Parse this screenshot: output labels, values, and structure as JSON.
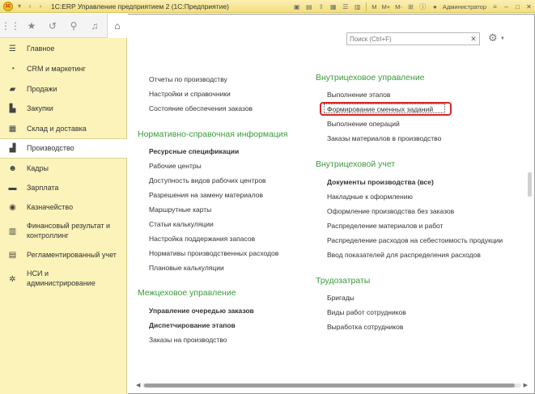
{
  "titlebar": {
    "logo": "1С",
    "title": "1С:ERP Управление предприятием 2  (1С:Предприятие)",
    "m_label": "M",
    "m_plus": "M+",
    "m_minus": "M-",
    "user": "Администратор"
  },
  "search": {
    "placeholder": "Поиск (Ctrl+F)"
  },
  "sidebar": {
    "items": [
      {
        "label": "Главное",
        "icon": "menu-icon"
      },
      {
        "label": "CRM и маркетинг",
        "icon": "crm-icon"
      },
      {
        "label": "Продажи",
        "icon": "sales-icon"
      },
      {
        "label": "Закупки",
        "icon": "cart-icon"
      },
      {
        "label": "Склад и доставка",
        "icon": "warehouse-icon"
      },
      {
        "label": "Производство",
        "icon": "factory-icon",
        "active": true
      },
      {
        "label": "Кадры",
        "icon": "person-icon"
      },
      {
        "label": "Зарплата",
        "icon": "money-icon"
      },
      {
        "label": "Казначейство",
        "icon": "treasury-icon"
      },
      {
        "label_line1": "Финансовый результат и",
        "label_line2": "контроллинг",
        "icon": "chart-icon"
      },
      {
        "label": "Регламентированный учет",
        "icon": "report-icon"
      },
      {
        "label_line1": "НСИ и",
        "label_line2": "администрирование",
        "icon": "gear-icon"
      }
    ]
  },
  "left_column": {
    "top_links": [
      "Отчеты по производству",
      "Настройки и справочники",
      "Состояние обеспечения заказов"
    ],
    "nsi": {
      "title": "Нормативно-справочная информация",
      "links": [
        {
          "label": "Ресурсные спецификации",
          "bold": true
        },
        {
          "label": "Рабочие центры"
        },
        {
          "label": "Доступность видов рабочих центров"
        },
        {
          "label": "Разрешения на замену материалов"
        },
        {
          "label": "Маршрутные карты"
        },
        {
          "label": "Статьи калькуляции"
        },
        {
          "label": "Настройка поддержания запасов"
        },
        {
          "label": "Нормативы производственных расходов"
        },
        {
          "label": "Плановые калькуляции"
        }
      ]
    },
    "inter": {
      "title": "Межцеховое управление",
      "links": [
        {
          "label": "Управление очередью заказов",
          "bold": true
        },
        {
          "label": "Диспетчирование этапов",
          "bold": true
        },
        {
          "label": "Заказы на производство"
        }
      ]
    }
  },
  "right_column": {
    "intra_mgmt": {
      "title": "Внутрицеховое управление",
      "links": [
        {
          "label": "Выполнение этапов"
        },
        {
          "label": "Формирование сменных заданий"
        },
        {
          "label": "Выполнение операций"
        },
        {
          "label": "Заказы материалов в производство"
        }
      ]
    },
    "intra_acc": {
      "title": "Внутрицеховой учет",
      "links": [
        {
          "label": "Документы производства (все)",
          "bold": true
        },
        {
          "label": "Накладные к оформлению"
        },
        {
          "label": "Оформление производства без заказов"
        },
        {
          "label": "Распределение материалов и работ"
        },
        {
          "label": "Распределение расходов на себестоимость продукции"
        },
        {
          "label": "Ввод показателей для распределения расходов"
        }
      ]
    },
    "labor": {
      "title": "Трудозатраты",
      "links": [
        {
          "label": "Бригады"
        },
        {
          "label": "Виды работ сотрудников"
        },
        {
          "label": "Выработка сотрудников"
        }
      ]
    }
  },
  "colors": {
    "sidebar_bg": "#fbf3b9",
    "section_title": "#3b9a3a",
    "highlight": "#d8262a"
  }
}
